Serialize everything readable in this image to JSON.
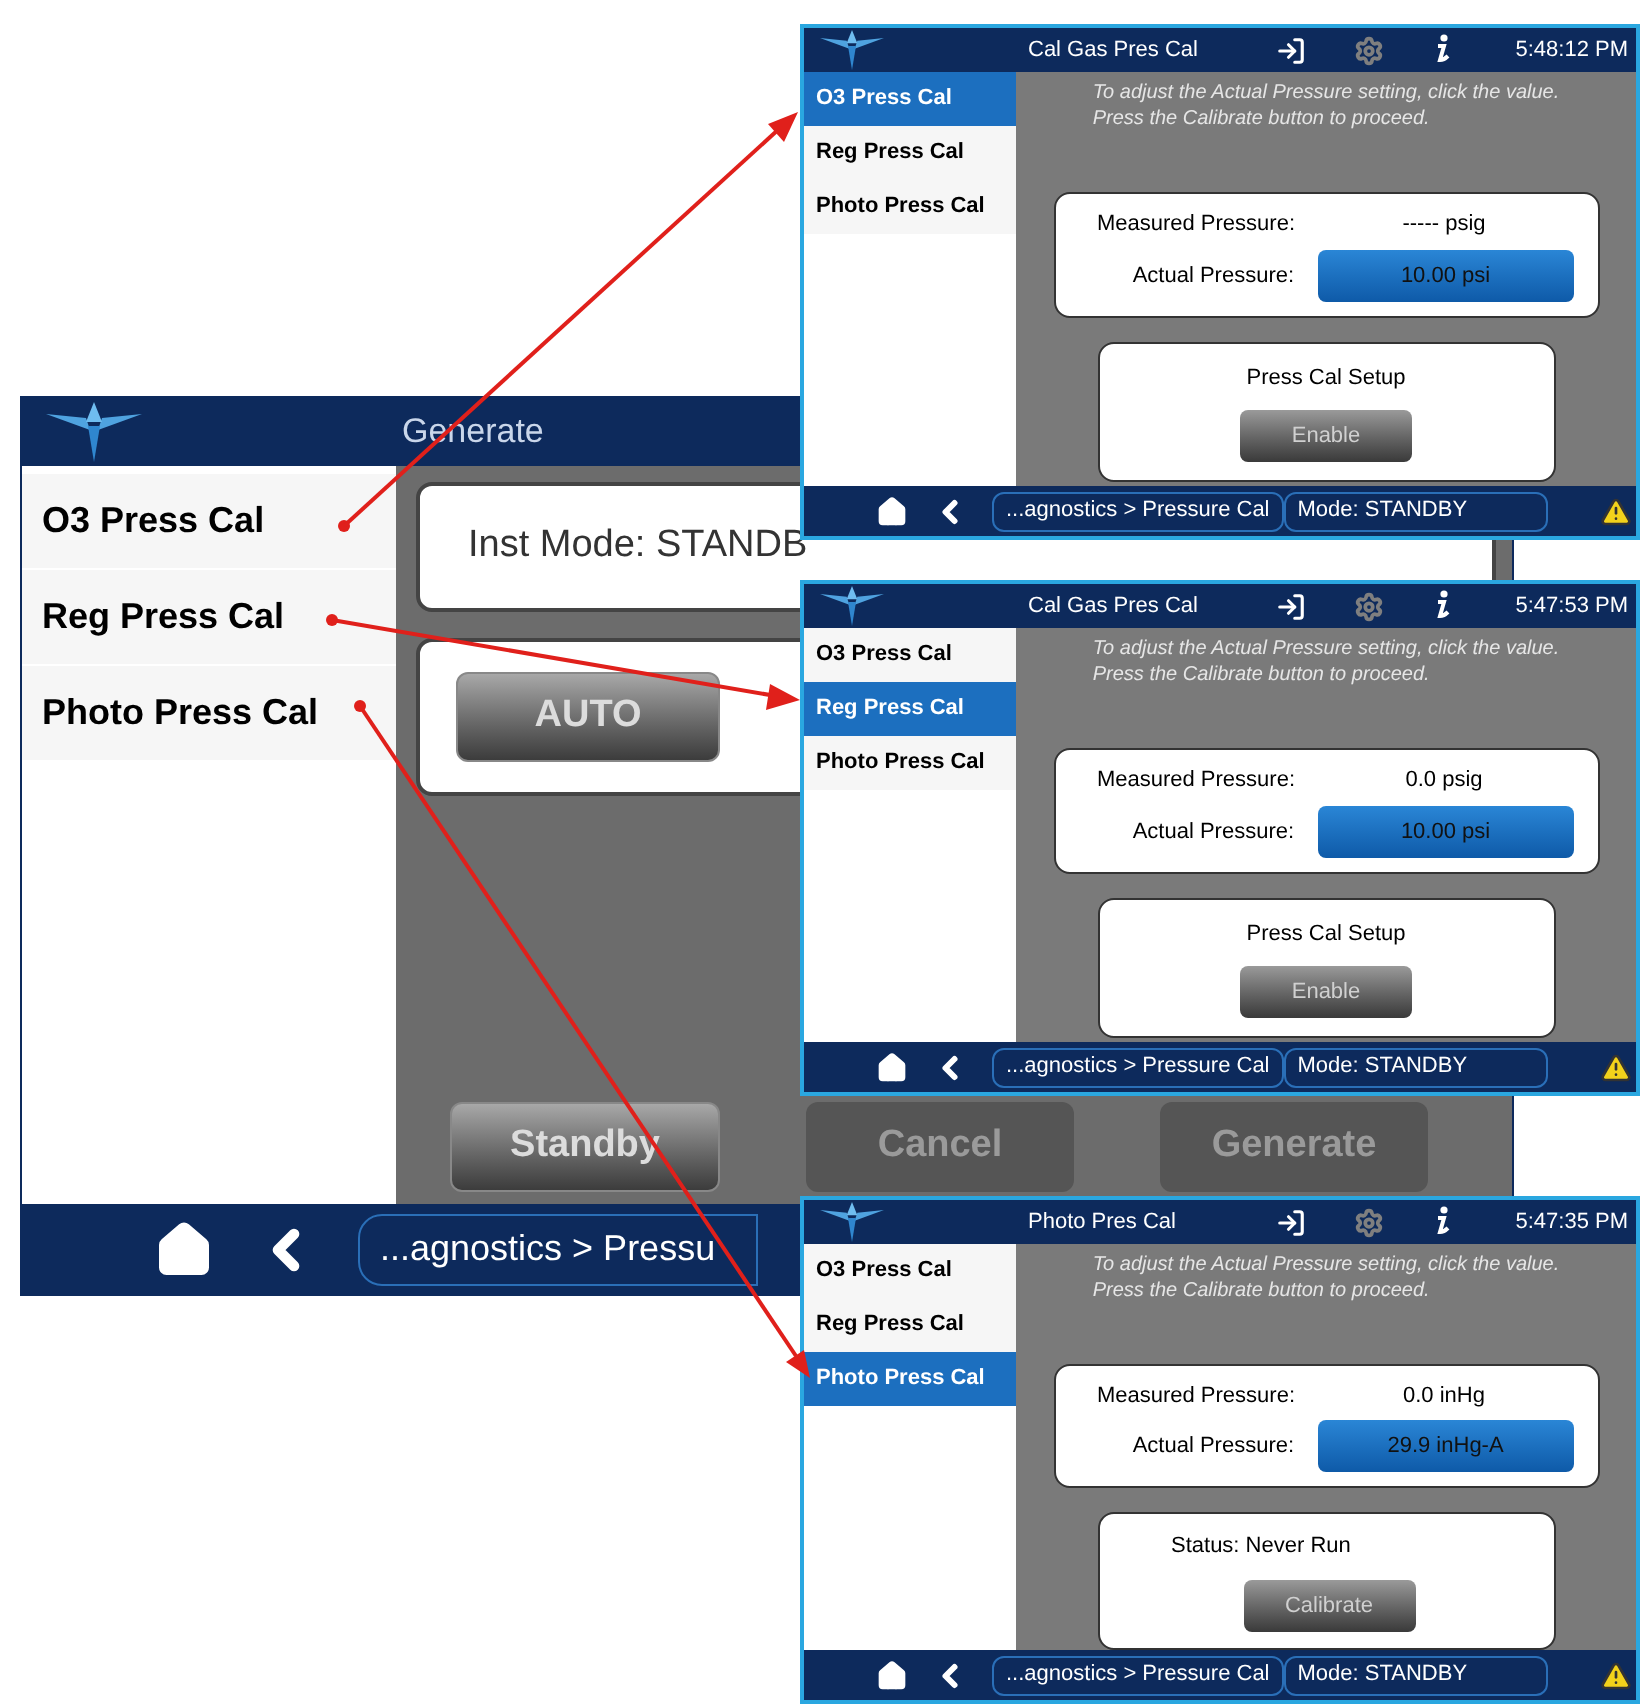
{
  "main_screen": {
    "title": "Generate",
    "sidebar": [
      {
        "label": "O3 Press Cal"
      },
      {
        "label": "Reg Press Cal"
      },
      {
        "label": "Photo Press Cal"
      }
    ],
    "inst_mode": "Inst Mode:  STANDB",
    "mode_button": {
      "label": "AUTO",
      "disabled": false
    },
    "buttons": [
      {
        "label": "Standby",
        "disabled": false
      },
      {
        "label": "Cancel",
        "disabled": true
      },
      {
        "label": "Generate",
        "disabled": true
      }
    ],
    "breadcrumb": "...agnostics > Pressu"
  },
  "screens": [
    {
      "title": "Cal Gas Pres Cal",
      "time": "5:48:12 PM",
      "sidebar": [
        {
          "label": "O3 Press Cal",
          "selected": true
        },
        {
          "label": "Reg Press Cal",
          "selected": false
        },
        {
          "label": "Photo Press Cal",
          "selected": false
        }
      ],
      "hint_lines": [
        "To adjust the Actual Pressure setting, click the value.",
        "Press the Calibrate button to proceed."
      ],
      "measured_label": "Measured Pressure:",
      "measured_value": "----- psig",
      "actual_label": "Actual Pressure:",
      "actual_value": "10.00 psi",
      "panel": {
        "kind": "setup",
        "text": "Press Cal Setup",
        "button": "Enable"
      },
      "breadcrumb": "...agnostics > Pressure Cal",
      "mode": "Mode: STANDBY"
    },
    {
      "title": "Cal Gas Pres Cal",
      "time": "5:47:53 PM",
      "sidebar": [
        {
          "label": "O3 Press Cal",
          "selected": false
        },
        {
          "label": "Reg Press Cal",
          "selected": true
        },
        {
          "label": "Photo Press Cal",
          "selected": false
        }
      ],
      "hint_lines": [
        "To adjust the Actual Pressure setting, click the value.",
        "Press the Calibrate button to proceed."
      ],
      "measured_label": "Measured Pressure:",
      "measured_value": "0.0 psig",
      "actual_label": "Actual Pressure:",
      "actual_value": "10.00 psi",
      "panel": {
        "kind": "setup",
        "text": "Press Cal Setup",
        "button": "Enable"
      },
      "breadcrumb": "...agnostics > Pressure Cal",
      "mode": "Mode: STANDBY"
    },
    {
      "title": "Photo Pres Cal",
      "time": "5:47:35 PM",
      "sidebar": [
        {
          "label": "O3 Press Cal",
          "selected": false
        },
        {
          "label": "Reg Press Cal",
          "selected": false
        },
        {
          "label": "Photo Press Cal",
          "selected": true
        }
      ],
      "hint_lines": [
        "To adjust the Actual Pressure setting, click the value.",
        "Press the Calibrate button to proceed."
      ],
      "measured_label": "Measured Pressure:",
      "measured_value": "0.0 inHg",
      "actual_label": "Actual Pressure:",
      "actual_value": "29.9 inHg-A",
      "panel": {
        "kind": "status",
        "text": "Status:  Never Run",
        "button": "Calibrate"
      },
      "breadcrumb": "...agnostics > Pressure Cal",
      "mode": "Mode: STANDBY"
    }
  ]
}
